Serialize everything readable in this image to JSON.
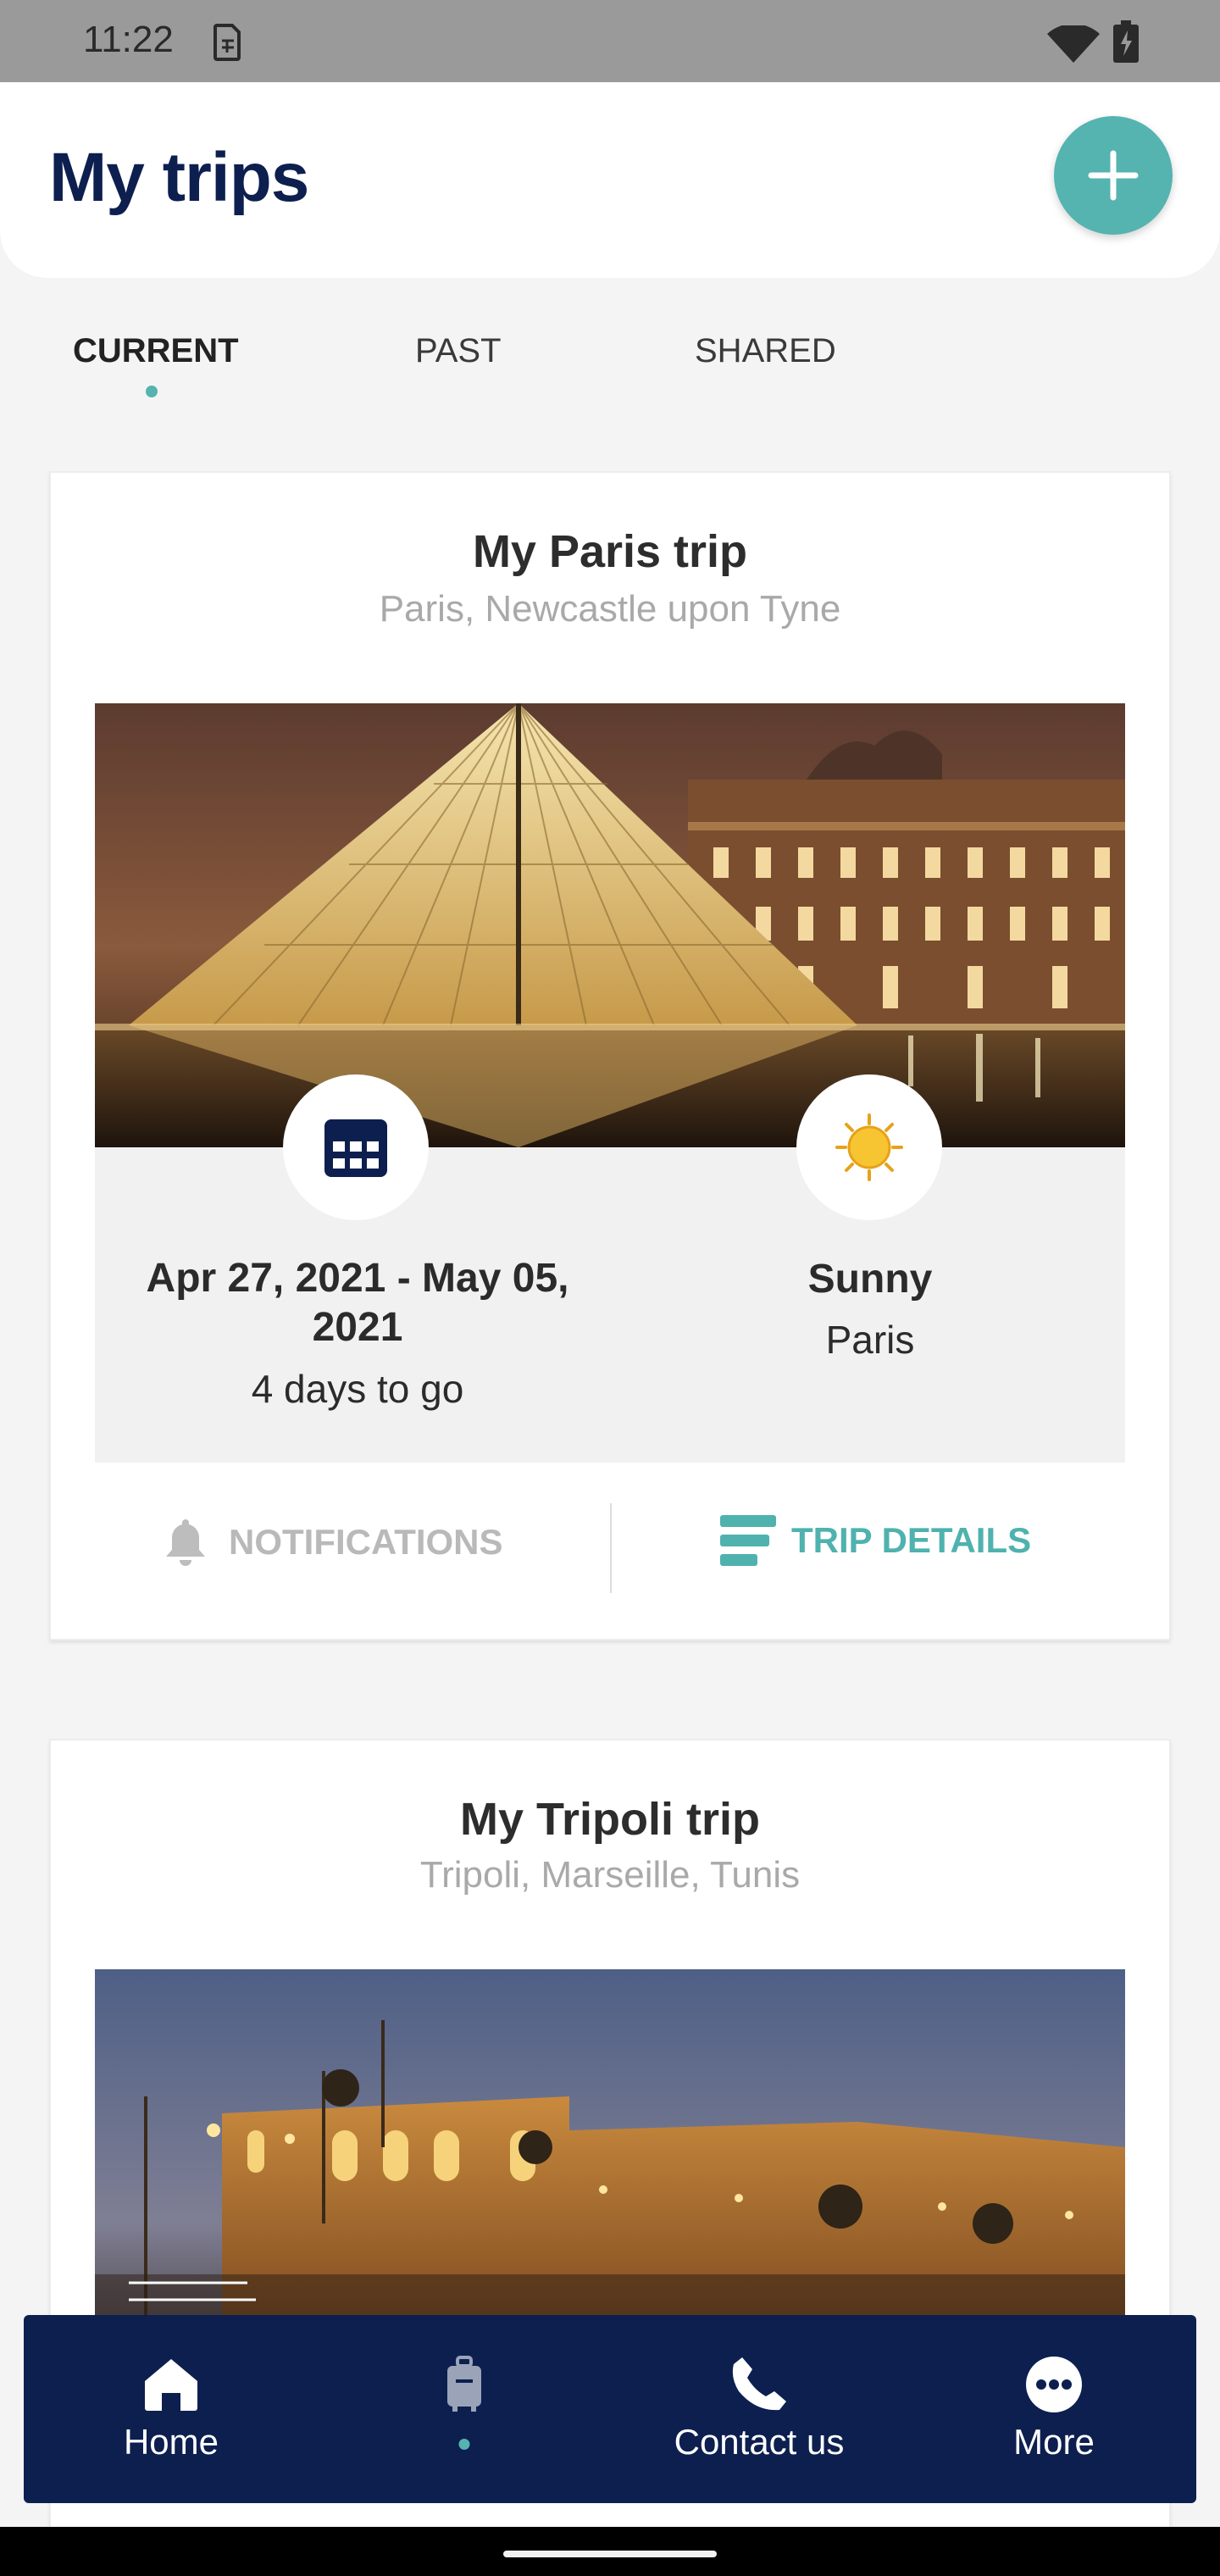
{
  "status_bar": {
    "time": "11:22"
  },
  "header": {
    "title": "My trips",
    "add_button_icon": "plus-icon"
  },
  "tabs": [
    {
      "label": "CURRENT",
      "active": true
    },
    {
      "label": "PAST",
      "active": false
    },
    {
      "label": "SHARED",
      "active": false
    }
  ],
  "trips": [
    {
      "title": "My Paris trip",
      "destinations": "Paris, Newcastle upon Tyne",
      "image": "louvre-pyramid-night-photo",
      "dates": "Apr 27, 2021 - May 05, 2021",
      "countdown": "4 days to go",
      "weather": "Sunny",
      "weather_icon": "sun-icon",
      "weather_city": "Paris",
      "actions": {
        "notifications": "NOTIFICATIONS",
        "details": "TRIP DETAILS"
      }
    },
    {
      "title": "My Tripoli trip",
      "destinations": "Tripoli, Marseille, Tunis",
      "image": "tripoli-castle-night-photo"
    }
  ],
  "bottom_nav": [
    {
      "label": "Home",
      "icon": "home-icon"
    },
    {
      "label": "",
      "icon": "luggage-icon",
      "active": true
    },
    {
      "label": "Contact us",
      "icon": "phone-icon"
    },
    {
      "label": "More",
      "icon": "more-icon"
    }
  ],
  "colors": {
    "accent": "#55b3b0",
    "navy": "#0c1f4f",
    "muted": "#a9a9a9"
  }
}
